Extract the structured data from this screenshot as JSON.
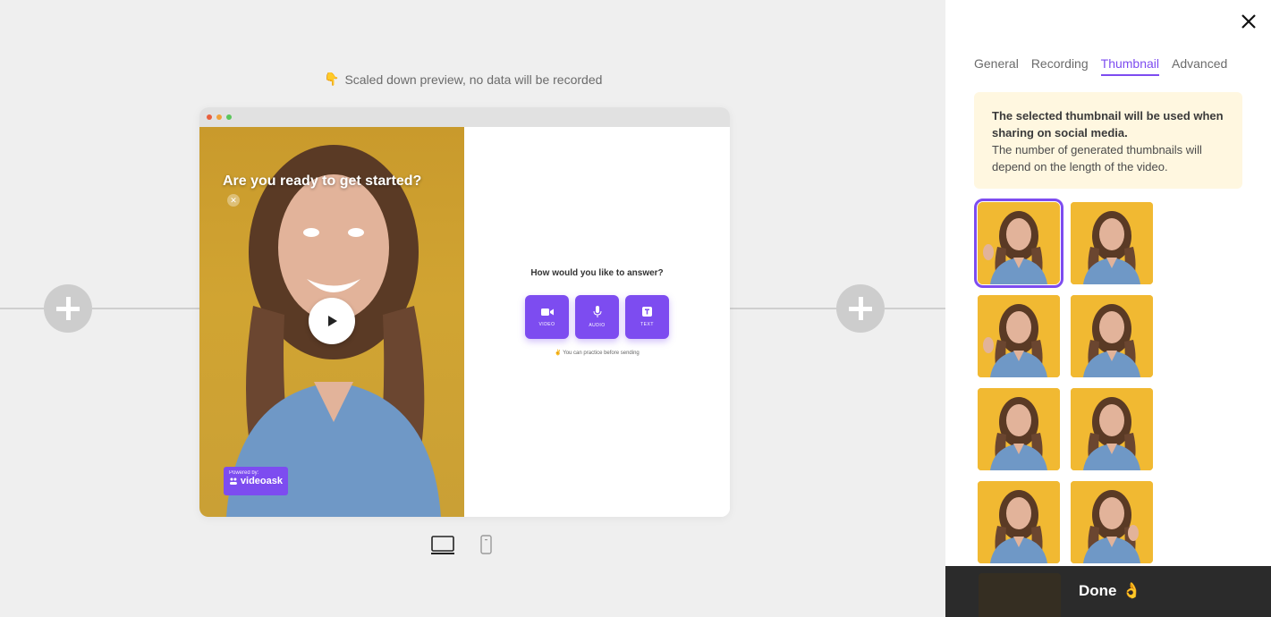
{
  "preview": {
    "note_icon": "👇",
    "note": "Scaled down preview, no data will be recorded"
  },
  "video": {
    "question": "Are you ready to get started?",
    "powered_by": "Powered by:",
    "brand": "videoask"
  },
  "answer": {
    "title": "How would you like to answer?",
    "buttons": [
      {
        "label": "VIDEO",
        "icon": "video-camera-icon"
      },
      {
        "label": "AUDIO",
        "icon": "microphone-icon"
      },
      {
        "label": "TEXT",
        "icon": "text-icon"
      }
    ],
    "practice_icon": "✌️",
    "practice": "You can practice before sending"
  },
  "device_toggle": {
    "options": [
      "desktop-icon",
      "mobile-icon"
    ],
    "selected": "desktop"
  },
  "panel": {
    "tabs": [
      "General",
      "Recording",
      "Thumbnail",
      "Advanced"
    ],
    "active_tab": "Thumbnail",
    "info_bold": "The selected thumbnail will be used when sharing on social media.",
    "info_text": "The number of generated thumbnails will depend on the length of the video.",
    "thumbnails_count": 9,
    "selected_thumbnail": 0,
    "done_label": "Done",
    "done_icon": "👌"
  },
  "colors": {
    "accent": "#7d4cf0",
    "thumb_bg": "#f1b932",
    "info_bg": "#fff7e0",
    "done_bar": "#2b2b2b"
  }
}
